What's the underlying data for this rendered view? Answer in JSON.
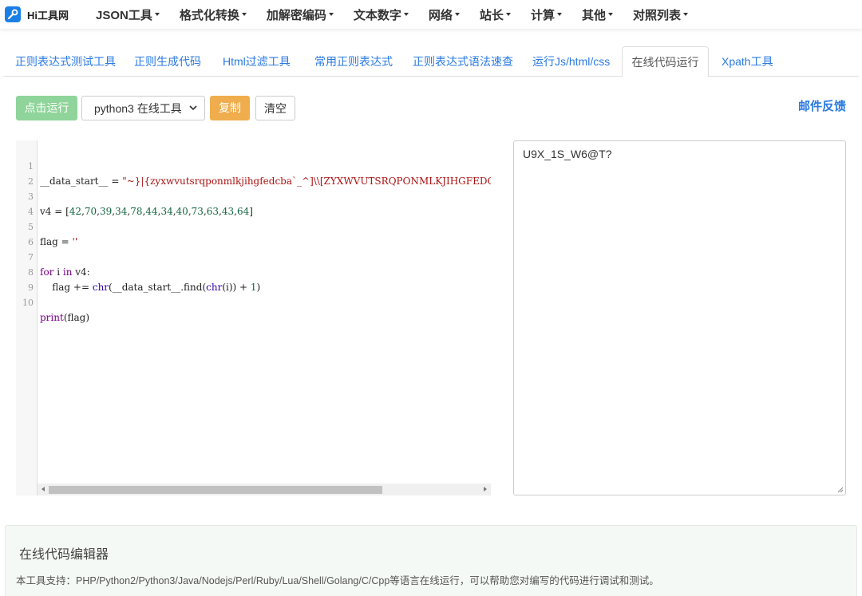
{
  "brand": {
    "name": "Hi工具网",
    "logo_icon": "wrench-icon",
    "logo_color": "#1c7fe6"
  },
  "nav": [
    {
      "label": "JSON工具"
    },
    {
      "label": "格式化转换"
    },
    {
      "label": "加解密编码"
    },
    {
      "label": "文本数字"
    },
    {
      "label": "网络"
    },
    {
      "label": "站长"
    },
    {
      "label": "计算"
    },
    {
      "label": "其他"
    },
    {
      "label": "对照列表"
    }
  ],
  "tabs": [
    {
      "label": "正则表达式测试工具",
      "active": false
    },
    {
      "label": "正则生成代码",
      "active": false
    },
    {
      "label": "Html过滤工具",
      "active": false
    },
    {
      "label": "常用正则表达式",
      "active": false
    },
    {
      "label": "正则表达式语法速查",
      "active": false
    },
    {
      "label": "运行Js/html/css",
      "active": false
    },
    {
      "label": "在线代码运行",
      "active": true
    },
    {
      "label": "Xpath工具",
      "active": false
    }
  ],
  "toolbar": {
    "run_label": "点击运行",
    "language_selected": "python3 在线工具",
    "copy_label": "复制",
    "clear_label": "清空",
    "feedback_label": "邮件反馈"
  },
  "editor": {
    "lines": [
      {
        "n": "1",
        "text": "__data_start__ = \"~}|{zyxwvutsrqponmlkjihgfedcba`_^]\\\\[ZYXWVUTSRQPONMLKJIHGFEDCBA@?>=<"
      },
      {
        "n": "2",
        "text": ""
      },
      {
        "n": "3",
        "text": "v4 = [42,70,39,34,78,44,34,40,73,63,43,64]"
      },
      {
        "n": "4",
        "text": ""
      },
      {
        "n": "5",
        "text": "flag = ''"
      },
      {
        "n": "6",
        "text": ""
      },
      {
        "n": "7",
        "text": "for i in v4:"
      },
      {
        "n": "8",
        "text": "    flag += chr(__data_start__.find(chr(i)) + 1)"
      },
      {
        "n": "9",
        "text": ""
      },
      {
        "n": "10",
        "text": "print(flag)"
      }
    ]
  },
  "output": {
    "text": "U9X_1S_W6@T?"
  },
  "info": {
    "title": "在线代码编辑器",
    "description": "本工具支持：PHP/Python2/Python3/Java/Nodejs/Perl/Ruby/Lua/Shell/Golang/C/Cpp等语言在线运行，可以帮助您对编写的代码进行调试和测试。"
  },
  "colors": {
    "accent": "#2a7ae2",
    "run_button": "#8fd49a",
    "copy_button": "#f0ad4e"
  }
}
